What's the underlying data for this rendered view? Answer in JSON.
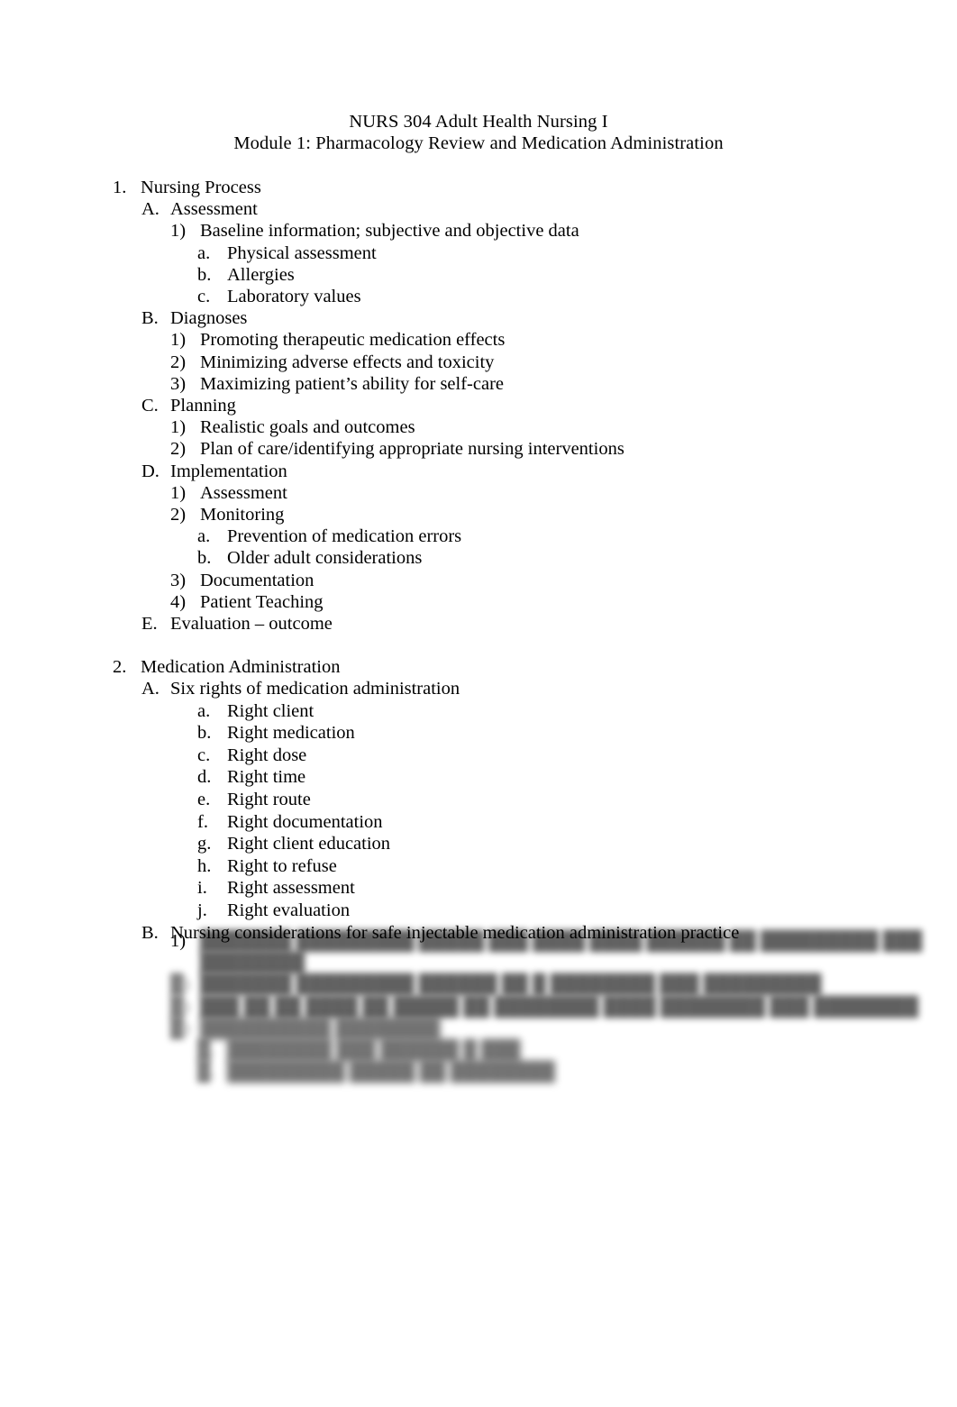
{
  "document": {
    "title_lines": [
      "NURS 304 Adult Health Nursing I",
      "Module 1: Pharmacology Review and Medication Administration"
    ]
  },
  "outline": {
    "section1": {
      "marker": "1.",
      "text": "Nursing Process",
      "items": [
        {
          "marker": "A.",
          "text": "Assessment",
          "children": [
            {
              "marker": "1)",
              "text": "Baseline information; subjective and objective data",
              "children": [
                {
                  "marker": "a.",
                  "text": "Physical assessment"
                },
                {
                  "marker": "b.",
                  "text": "Allergies"
                },
                {
                  "marker": "c.",
                  "text": "Laboratory values"
                }
              ]
            }
          ]
        },
        {
          "marker": "B.",
          "text": "Diagnoses",
          "children": [
            {
              "marker": "1)",
              "text": "Promoting therapeutic medication effects"
            },
            {
              "marker": "2)",
              "text": "Minimizing adverse effects and toxicity"
            },
            {
              "marker": "3)",
              "text": "Maximizing patient’s ability for self-care"
            }
          ]
        },
        {
          "marker": "C.",
          "text": "Planning",
          "children": [
            {
              "marker": "1)",
              "text": "Realistic goals and outcomes"
            },
            {
              "marker": "2)",
              "text": "Plan of care/identifying appropriate nursing interventions"
            }
          ]
        },
        {
          "marker": "D.",
          "text": "Implementation",
          "children": [
            {
              "marker": "1)",
              "text": "Assessment"
            },
            {
              "marker": "2)",
              "text": "Monitoring",
              "children": [
                {
                  "marker": "a.",
                  "text": "Prevention of medication errors"
                },
                {
                  "marker": "b.",
                  "text": "Older adult considerations"
                }
              ]
            },
            {
              "marker": "3)",
              "text": "Documentation"
            },
            {
              "marker": "4)",
              "text": "Patient Teaching"
            }
          ]
        },
        {
          "marker": "E.",
          "text": "Evaluation – outcome"
        }
      ]
    },
    "section2": {
      "marker": "2.",
      "text": "Medication Administration",
      "items": [
        {
          "marker": "A.",
          "text": "Six rights of medication administration",
          "children": [
            {
              "marker": "a.",
              "text": "Right client"
            },
            {
              "marker": "b.",
              "text": "Right medication"
            },
            {
              "marker": "c.",
              "text": "Right dose"
            },
            {
              "marker": "d.",
              "text": "Right time"
            },
            {
              "marker": "e.",
              "text": "Right route"
            },
            {
              "marker": "f.",
              "text": "Right documentation"
            },
            {
              "marker": "g.",
              "text": "Right client education"
            },
            {
              "marker": "h.",
              "text": "Right to refuse"
            },
            {
              "marker": "i.",
              "text": "Right assessment"
            },
            {
              "marker": "j.",
              "text": "Right evaluation"
            }
          ]
        },
        {
          "marker": "B.",
          "text": "Nursing considerations for safe injectable medication administration practice",
          "redacted": true
        }
      ]
    }
  },
  "redacted_block": {
    "note": "Text in this block is visually blurred and unreadable in the screenshot.",
    "rows": [
      {
        "marker": "1)",
        "marker_legible": true,
        "text": "███████ █████████ █████ ███ ████ ████ ██████ ██ █████████ ███",
        "level": 3
      },
      {
        "marker": "",
        "marker_legible": false,
        "text": "████████",
        "level": 3,
        "continuation": true
      },
      {
        "marker": "█)",
        "marker_legible": false,
        "text": "███████ █████████ ██████ ██ █ ████████ ███ █████████",
        "level": 3
      },
      {
        "marker": "█)",
        "marker_legible": false,
        "text": "███ ██ ██ ████ ██ █████ ██ ████████ ████ ████████ ███ ████████",
        "level": 3
      },
      {
        "marker": "█)",
        "marker_legible": false,
        "text": "██████████ ████████",
        "level": 3
      },
      {
        "marker": "█.",
        "marker_legible": false,
        "text": "████████ ███ ██████ █ ███",
        "level": 4
      },
      {
        "marker": "█.",
        "marker_legible": false,
        "text": "█████████ █████ ██ ████████",
        "level": 4
      }
    ]
  }
}
